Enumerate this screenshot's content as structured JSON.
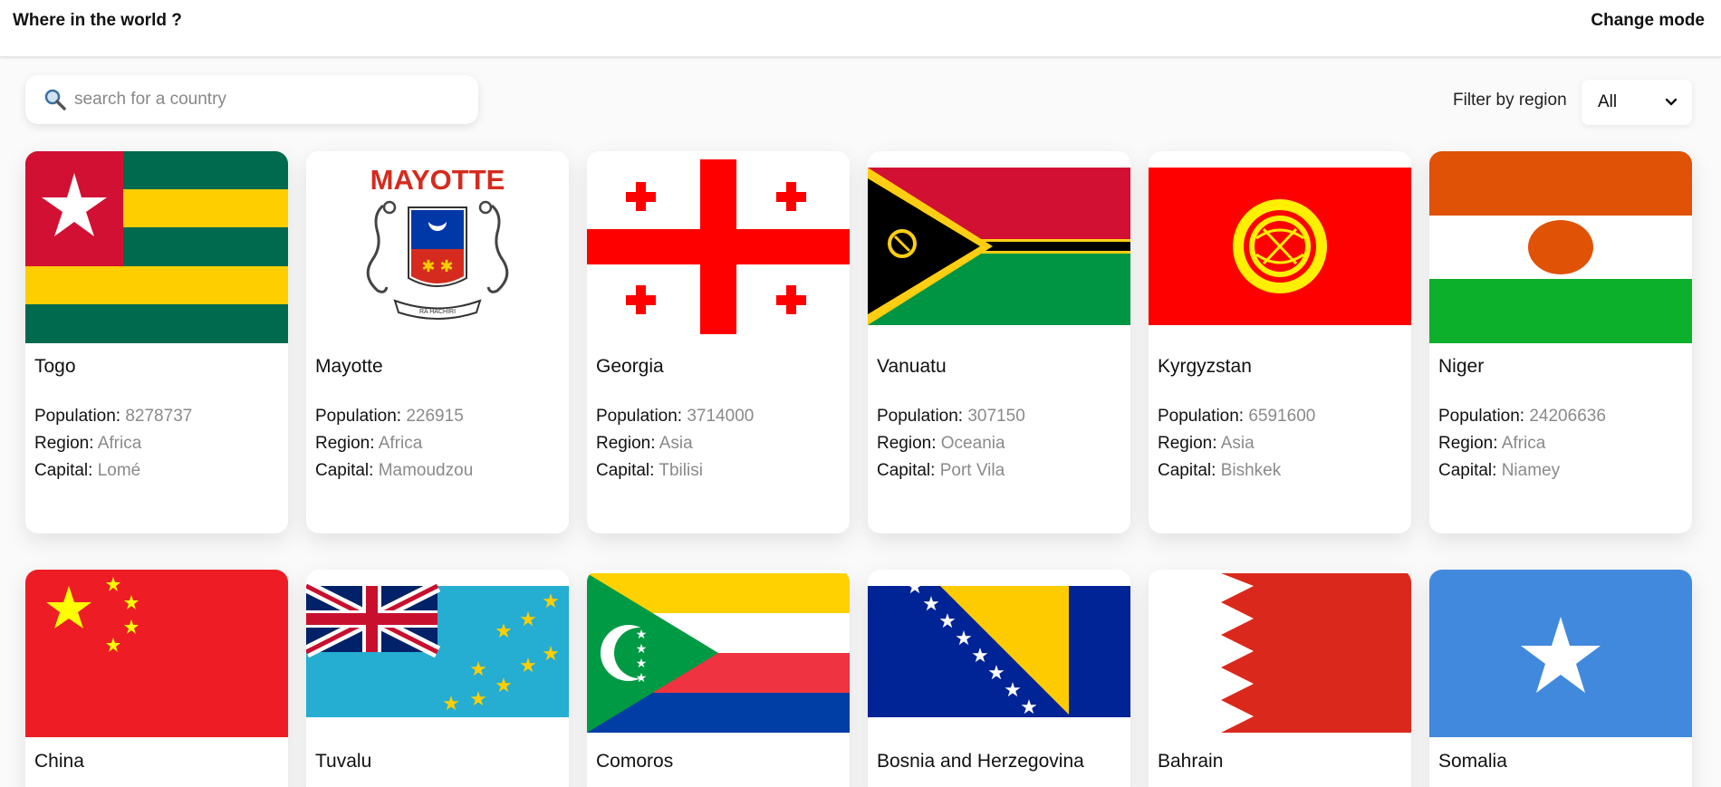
{
  "header": {
    "title": "Where in the world ?",
    "mode_label": "Change mode"
  },
  "search": {
    "placeholder": "search for a country",
    "value": ""
  },
  "filter": {
    "label": "Filter by region",
    "selected": "All"
  },
  "labels": {
    "population": "Population: ",
    "region": "Region: ",
    "capital": "Capital: "
  },
  "countries": [
    {
      "name": "Togo",
      "population": "8278737",
      "region": "Africa",
      "capital": "Lomé"
    },
    {
      "name": "Mayotte",
      "population": "226915",
      "region": "Africa",
      "capital": "Mamoudzou",
      "flag_text": "MAYOTTE",
      "motto": "RA HACHIRI"
    },
    {
      "name": "Georgia",
      "population": "3714000",
      "region": "Asia",
      "capital": "Tbilisi"
    },
    {
      "name": "Vanuatu",
      "population": "307150",
      "region": "Oceania",
      "capital": "Port Vila"
    },
    {
      "name": "Kyrgyzstan",
      "population": "6591600",
      "region": "Asia",
      "capital": "Bishkek"
    },
    {
      "name": "Niger",
      "population": "24206636",
      "region": "Africa",
      "capital": "Niamey"
    },
    {
      "name": "China"
    },
    {
      "name": "Tuvalu"
    },
    {
      "name": "Comoros"
    },
    {
      "name": "Bosnia and Herzegovina"
    },
    {
      "name": "Bahrain"
    },
    {
      "name": "Somalia"
    }
  ],
  "colors": {
    "background": "#fafafa",
    "card": "#ffffff",
    "muted_value": "#8a8a8a"
  }
}
